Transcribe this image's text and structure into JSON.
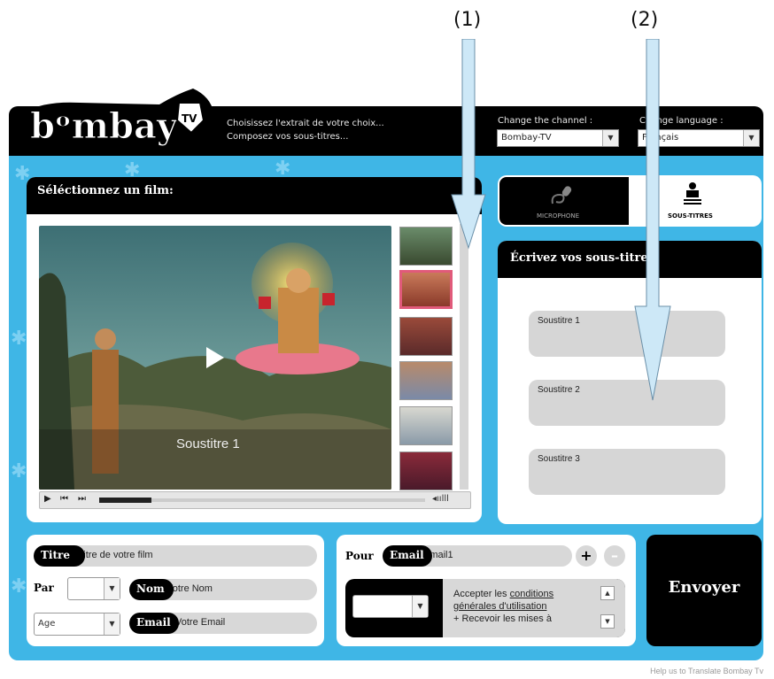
{
  "annotations": {
    "label1": "(1)",
    "label2": "(2)"
  },
  "header": {
    "logo_text": "Bombay TV",
    "instructions_line1": "Choisissez l'extrait de votre choix...",
    "instructions_line2": "Composez vos sous-titres...",
    "channel_label": "Change the channel :",
    "channel_value": "Bombay-TV",
    "language_label": "Change language :",
    "language_value": "Français"
  },
  "film_panel": {
    "title": "Séléctionnez un film:",
    "subtitle_overlay": "Soustitre 1",
    "progress": 0.16,
    "thumbnails": 6,
    "active_thumbnail": 2
  },
  "tabs": {
    "microphone": "MICROPHONE",
    "subtitles": "SOUS-TITRES"
  },
  "subs_panel": {
    "title": "Écrivez vos sous-titres:",
    "fields": [
      "Soustitre 1",
      "Soustitre 2",
      "Soustitre 3"
    ]
  },
  "form": {
    "titre_label": "Titre",
    "titre_value": "Titre de votre film",
    "par_label": "Par",
    "nom_label": "Nom",
    "nom_value": "Votre Nom",
    "age_value": "Age",
    "email_label": "Email",
    "email_value": "Votre Email"
  },
  "recipients": {
    "pour_label": "Pour",
    "email_label": "Email",
    "email_value": "Email1",
    "add_label": "+",
    "remove_label": "–",
    "terms_prefix": "Accepter les ",
    "terms_link": "conditions générales d'utilisation",
    "terms_suffix": "+ Recevoir les mises à"
  },
  "send_label": "Envoyer",
  "footer_link": "Help us to Translate Bombay Tv"
}
